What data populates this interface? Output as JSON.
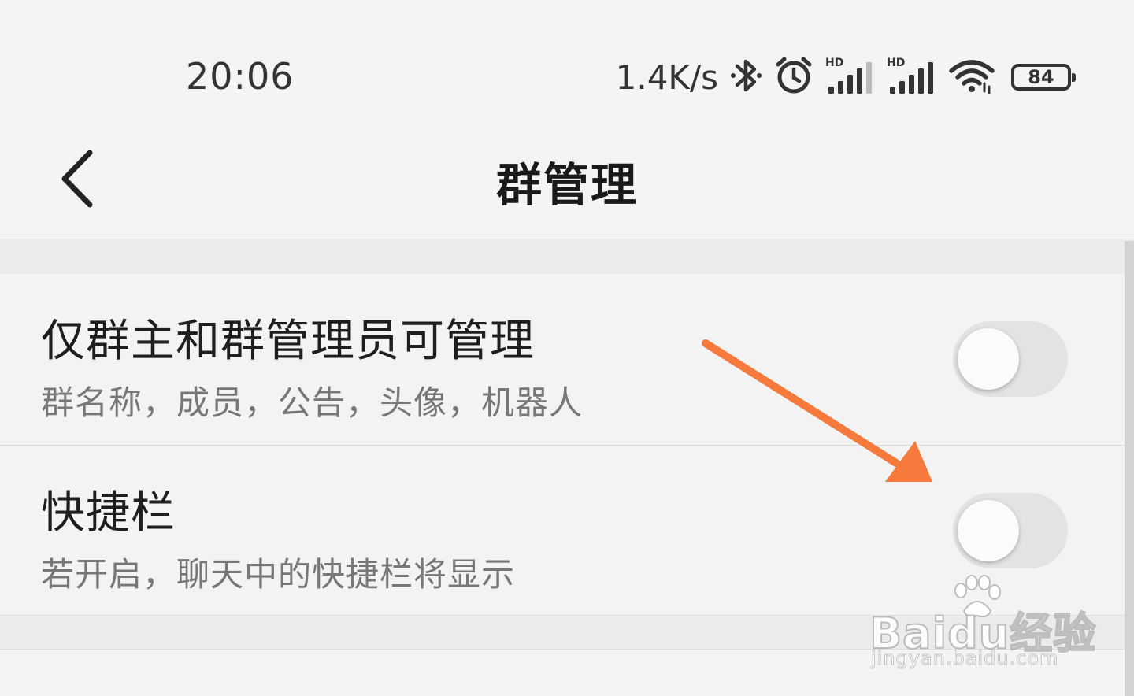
{
  "status_bar": {
    "time": "20:06",
    "net_speed": "1.4K/s",
    "hd_label_1": "HD",
    "hd_label_2": "HD",
    "battery_level": "84",
    "icons": [
      "bluetooth-icon",
      "alarm-icon",
      "signal-icon",
      "signal-icon",
      "wifi-icon",
      "battery-icon"
    ]
  },
  "nav": {
    "back_icon": "chevron-left-icon",
    "title": "群管理"
  },
  "settings": [
    {
      "title": "仅群主和群管理员可管理",
      "description": "群名称，成员，公告，头像，机器人",
      "enabled": false
    },
    {
      "title": "快捷栏",
      "description": "若开启，聊天中的快捷栏将显示",
      "enabled": false
    }
  ],
  "annotation": {
    "arrow_color": "#f57a3b"
  },
  "watermark": {
    "main": "Baidu经验",
    "sub": "jingyan.baidu.com"
  }
}
